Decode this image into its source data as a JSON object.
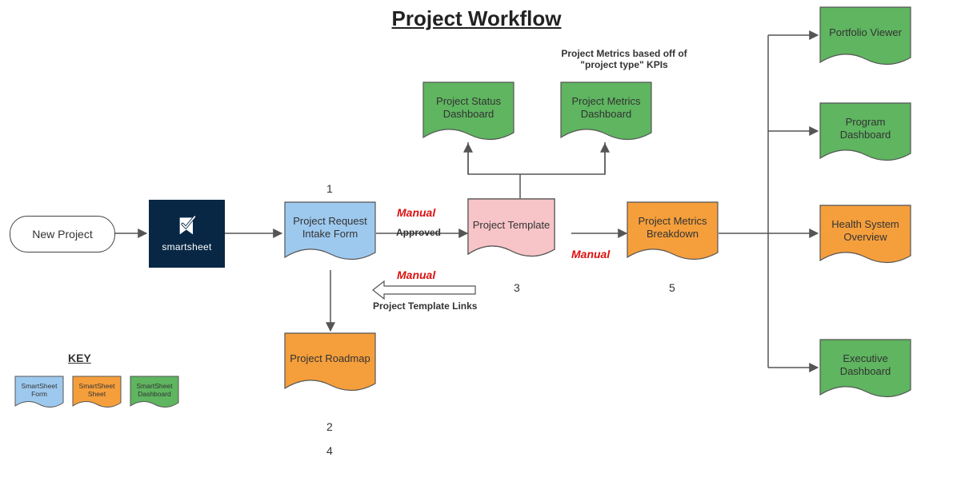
{
  "title": "Project Workflow",
  "start": "New Project",
  "smartsheet_brand": "smartsheet",
  "nodes": {
    "intake": "Project Request Intake Form",
    "roadmap": "Project Roadmap",
    "template": "Project Template",
    "status_dash": "Project Status Dashboard",
    "metrics_dash": "Project Metrics Dashboard",
    "metrics_breakdown": "Project Metrics Breakdown",
    "portfolio": "Portfolio Viewer",
    "program": "Program Dashboard",
    "health": "Health System Overview",
    "exec": "Executive Dashboard"
  },
  "edge_labels": {
    "approved": "Approved",
    "manual": "Manual",
    "template_links": "Project Template Links",
    "metrics_note_l1": "Project Metrics based off of",
    "metrics_note_l2": "\"project type\" KPIs"
  },
  "numbers": {
    "n1": "1",
    "n2": "2",
    "n3": "3",
    "n4": "4",
    "n5": "5"
  },
  "key": {
    "title": "KEY",
    "form": "SmartSheet Form",
    "sheet": "SmartSheet Sheet",
    "dashboard": "SmartSheet Dashboard"
  },
  "colors": {
    "blue": "#9ec9ef",
    "orange": "#f59f3c",
    "green": "#5fb560",
    "pink": "#f7c4c8",
    "stroke": "#555"
  }
}
